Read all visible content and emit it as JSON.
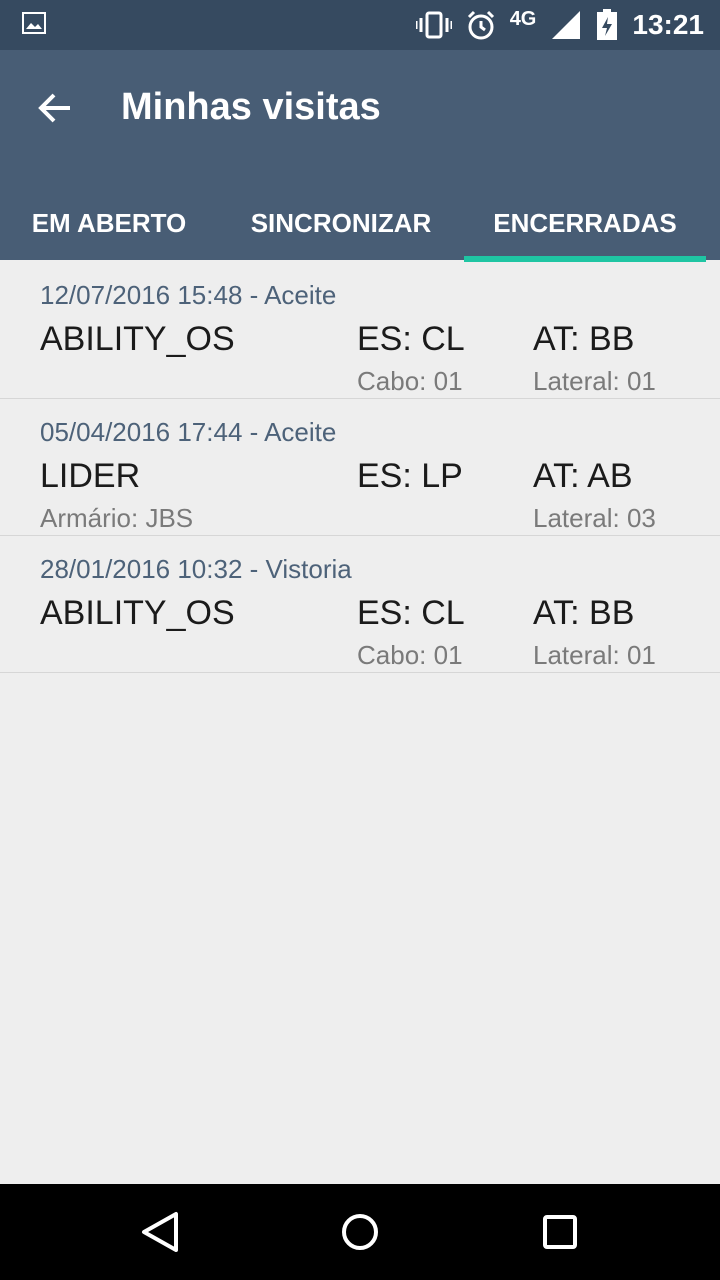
{
  "status_bar": {
    "network": "4G",
    "time": "13:21",
    "icons": [
      "image-icon",
      "vibrate-icon",
      "alarm-icon",
      "signal-icon",
      "battery-icon"
    ]
  },
  "app_bar": {
    "title": "Minhas visitas",
    "back_icon": "arrow-back-icon"
  },
  "tabs": [
    {
      "label": "EM ABERTO"
    },
    {
      "label": "SINCRONIZAR"
    },
    {
      "label": "ENCERRADAS",
      "selected": true
    }
  ],
  "colors": {
    "status_bar": "#364a60",
    "app_bar": "#485d75",
    "tab_indicator": "#1fc5a3",
    "date_text": "#4d6279"
  },
  "visits": [
    {
      "date": "12/07/2016 15:48 - Aceite",
      "name": "ABILITY_OS",
      "es": "ES: CL",
      "at": "AT: BB",
      "sub1": "",
      "sub2": "Cabo: 01",
      "sub3": "Lateral: 01"
    },
    {
      "date": "05/04/2016 17:44 - Aceite",
      "name": "LIDER",
      "es": "ES: LP",
      "at": "AT: AB",
      "sub1": "Armário: JBS",
      "sub2": "",
      "sub3": "Lateral: 03"
    },
    {
      "date": "28/01/2016 10:32 - Vistoria",
      "name": "ABILITY_OS",
      "es": "ES: CL",
      "at": "AT: BB",
      "sub1": "",
      "sub2": "Cabo: 01",
      "sub3": "Lateral: 01"
    }
  ],
  "nav_bar": {
    "icons": [
      "back-triangle-icon",
      "home-circle-icon",
      "recents-square-icon"
    ]
  }
}
